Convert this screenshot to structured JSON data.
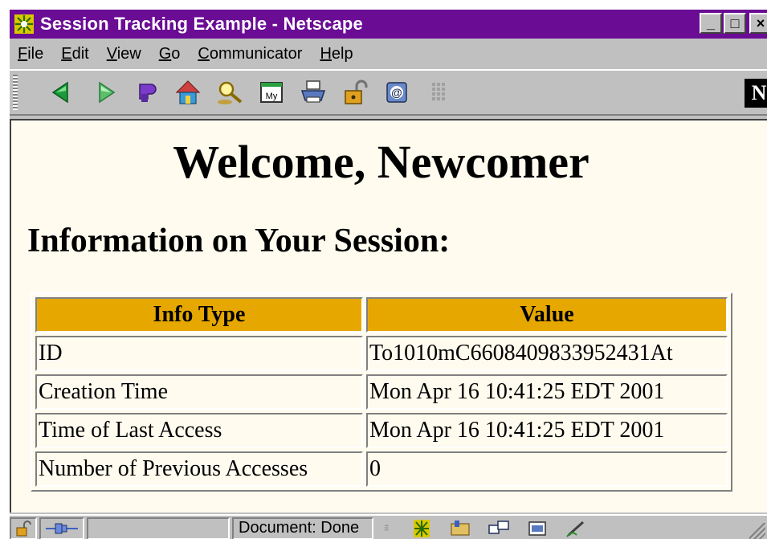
{
  "window": {
    "title": "Session Tracking Example - Netscape",
    "controls": {
      "minimize": "_",
      "maximize": "□",
      "close": "×"
    }
  },
  "menubar": {
    "items": [
      {
        "label": "File",
        "accel": "F",
        "rest": "ile"
      },
      {
        "label": "Edit",
        "accel": "E",
        "rest": "dit"
      },
      {
        "label": "View",
        "accel": "V",
        "rest": "iew"
      },
      {
        "label": "Go",
        "accel": "G",
        "rest": "o"
      },
      {
        "label": "Communicator",
        "accel": "C",
        "rest": "ommunicator"
      },
      {
        "label": "Help",
        "accel": "H",
        "rest": "elp"
      }
    ]
  },
  "toolbar": {
    "buttons": [
      "back-icon",
      "forward-icon",
      "reload-icon",
      "home-icon",
      "search-icon",
      "my-netscape-icon",
      "print-icon",
      "security-icon",
      "shop-icon",
      "stop-icon"
    ],
    "my_label": "My",
    "logo": "N"
  },
  "page": {
    "heading": "Welcome, Newcomer",
    "subheading": "Information on Your Session:",
    "table": {
      "headers": [
        "Info Type",
        "Value"
      ],
      "rows": [
        [
          "ID",
          "To1010mC6608409833952431At"
        ],
        [
          "Creation Time",
          "Mon Apr 16 10:41:25 EDT 2001"
        ],
        [
          "Time of Last Access",
          "Mon Apr 16 10:41:25 EDT 2001"
        ],
        [
          "Number of Previous Accesses",
          "0"
        ]
      ]
    }
  },
  "statusbar": {
    "status": "Document: Done"
  },
  "colors": {
    "titlebar": "#6a0c94",
    "chrome": "#c0c0c0",
    "page_background": "#fffbef",
    "table_header": "#e6a800"
  }
}
